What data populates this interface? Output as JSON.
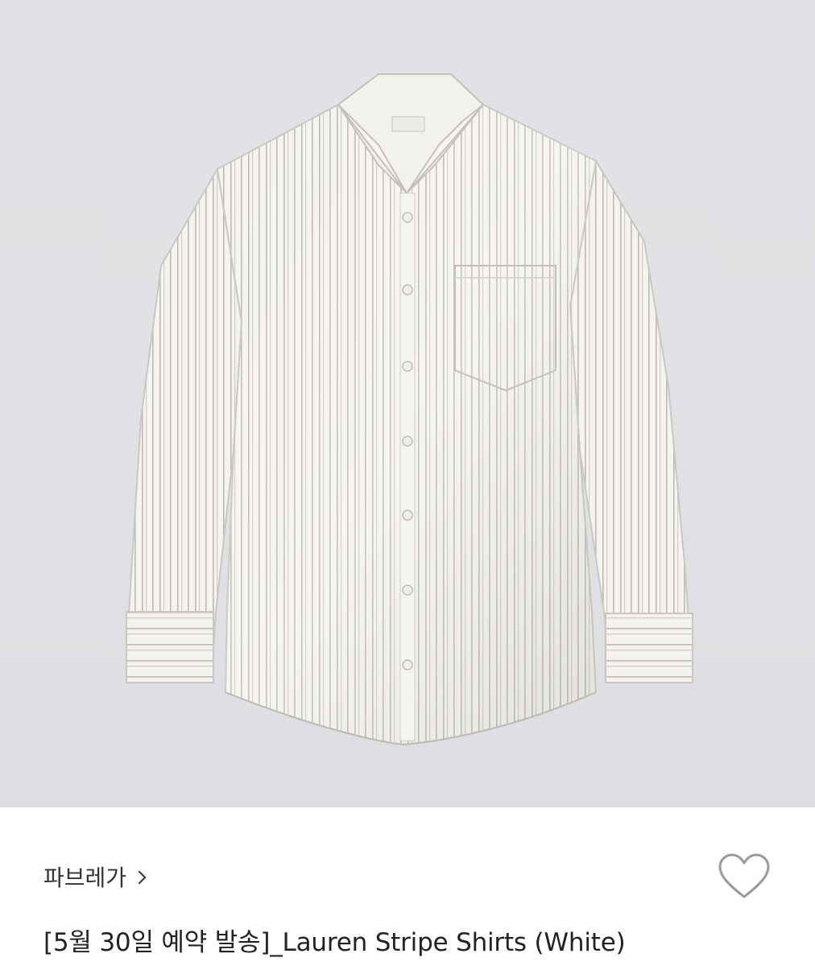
{
  "product": {
    "brand": "파브레가",
    "title": "[5월 30일 예약 발송]_Lauren Stripe Shirts (White)",
    "image_alt": "Lauren Stripe Shirts (White) product photo",
    "background_color": "#dfe1e4",
    "shirt_color": "#f4f3ef",
    "stripe_color": "#b9b7ad"
  },
  "icons": {
    "brand_chevron": "chevron-right-icon",
    "wishlist": "heart-outline-icon"
  }
}
